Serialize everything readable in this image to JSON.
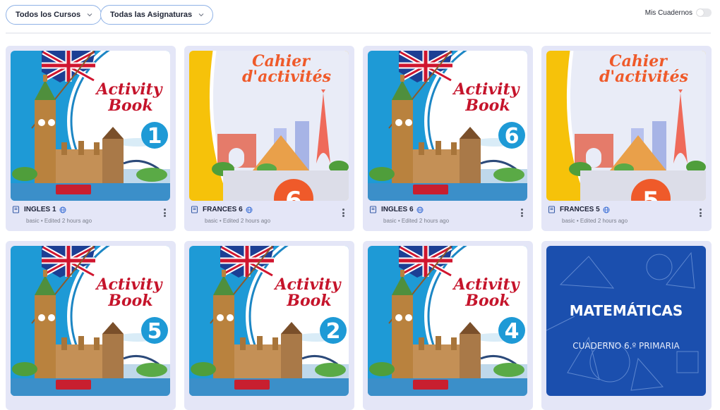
{
  "filters": {
    "courses_label": "Todos los Cursos",
    "subjects_label": "Todas las Asignaturas"
  },
  "toggle": {
    "label": "Mis Cuadernos",
    "on": false
  },
  "notebooks": [
    {
      "title": "INGLES 1",
      "subtitle": "basic • Edited 2 hours ago",
      "cover": "activity",
      "cover_word1": "Activity",
      "cover_word2": "Book",
      "number": "1"
    },
    {
      "title": "FRANCES 6",
      "subtitle": "basic • Edited 2 hours ago",
      "cover": "cahier",
      "cover_word1": "Cahier",
      "cover_word2": "d'activités",
      "number": "6"
    },
    {
      "title": "INGLES 6",
      "subtitle": "basic • Edited 2 hours ago",
      "cover": "activity",
      "cover_word1": "Activity",
      "cover_word2": "Book",
      "number": "6"
    },
    {
      "title": "FRANCES 5",
      "subtitle": "basic • Edited 2 hours ago",
      "cover": "cahier",
      "cover_word1": "Cahier",
      "cover_word2": "d'activités",
      "number": "5"
    },
    {
      "cover": "activity",
      "cover_word1": "Activity",
      "cover_word2": "Book",
      "number": "5"
    },
    {
      "cover": "activity",
      "cover_word1": "Activity",
      "cover_word2": "Book",
      "number": "2"
    },
    {
      "cover": "activity",
      "cover_word1": "Activity",
      "cover_word2": "Book",
      "number": "4"
    },
    {
      "cover": "math",
      "cover_word1": "MATEMÁTICAS",
      "cover_word2": "CUADERNO 6.º PRIMARIA"
    }
  ],
  "colors": {
    "card_bg": "#e4e6f7",
    "filter_border": "#8fb2e6",
    "activity_blue": "#1e9ad6",
    "cahier_yellow": "#f6c20a",
    "math_blue": "#1b4fae",
    "title_red": "#c5142b",
    "cahier_orange": "#ef5a2a"
  },
  "icons": [
    "chevron-down-icon",
    "notebook-icon",
    "globe-icon",
    "more-vertical-icon"
  ]
}
